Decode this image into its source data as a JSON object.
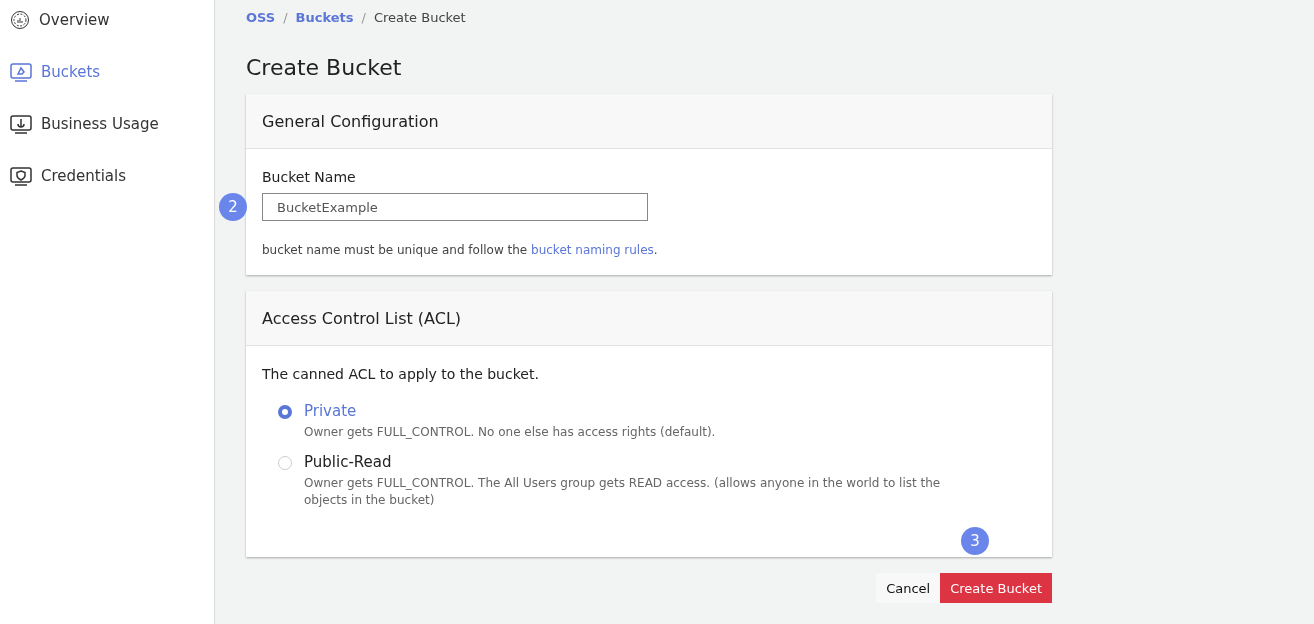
{
  "sidebar": {
    "items": [
      {
        "label": "Overview",
        "selected": false
      },
      {
        "label": "Buckets",
        "selected": true
      },
      {
        "label": "Business Usage",
        "selected": false
      },
      {
        "label": "Credentials",
        "selected": false
      }
    ]
  },
  "breadcrumb": [
    {
      "label": "OSS",
      "kind": "link"
    },
    {
      "label": "/",
      "kind": "separator"
    },
    {
      "label": "Buckets",
      "kind": "link"
    },
    {
      "label": "/",
      "kind": "separator"
    },
    {
      "label": "Create Bucket",
      "kind": "current"
    }
  ],
  "title": "Create Bucket",
  "general": {
    "title": "General Configuration",
    "field_label": "Bucket Name",
    "value": "BucketExample",
    "help": "bucket name must be unique and follow the ",
    "help_link": "bucket naming rules",
    "help_end": ".",
    "step": "2"
  },
  "acl": {
    "title": "Access Control List (ACL)",
    "intro": "The canned ACL to apply to the bucket.",
    "options": [
      {
        "label": "Private",
        "description": "Owner gets FULL_CONTROL. No one else has access rights (default).",
        "selected": true
      },
      {
        "label": "Public-Read",
        "description": "Owner gets FULL_CONTROL. The All Users group gets READ access. (allows anyone in the world to list the objects in the bucket)",
        "selected": false
      }
    ],
    "step": "3"
  },
  "buttons": [
    {
      "label": "Cancel",
      "kind": "secondary"
    },
    {
      "label": "Create Bucket",
      "kind": "primary"
    }
  ]
}
